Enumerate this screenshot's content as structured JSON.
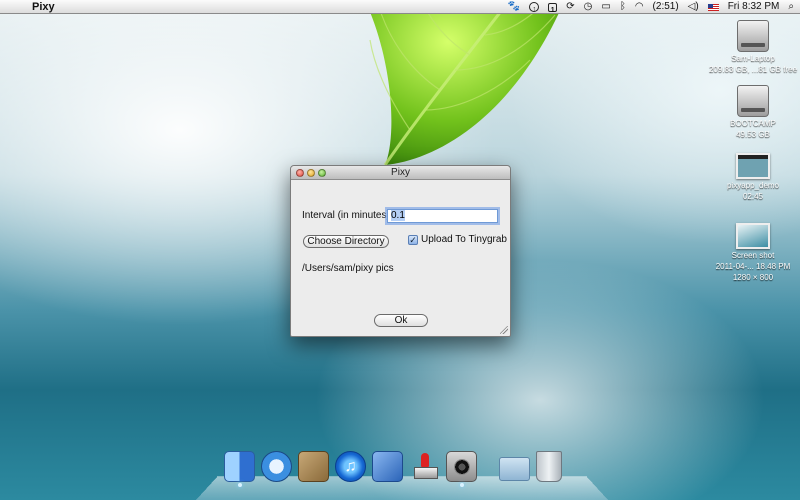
{
  "menubar": {
    "app_name": "Pixy",
    "battery": "(2:51)",
    "clock": "Fri 8:32 PM",
    "icons": [
      "apple-icon",
      "paw-icon",
      "arrow-circle-icon",
      "one-box-icon",
      "sync-icon",
      "time-machine-icon",
      "display-icon",
      "bluetooth-icon",
      "wifi-icon",
      "volume-icon",
      "flag-icon",
      "spotlight-icon"
    ]
  },
  "desktop_icons": [
    {
      "name": "Sam-Laptop",
      "detail": "209.83 GB, ...81 GB free"
    },
    {
      "name": "BOOTCAMP",
      "detail": "49.53 GB"
    },
    {
      "name": "pixyapp_demo",
      "detail": "02:45"
    },
    {
      "name": "Screen shot",
      "detail": "2011-04-... 18.48 PM",
      "size": "1280 × 800"
    }
  ],
  "window": {
    "title": "Pixy",
    "interval_label": "Interval (in minutes):",
    "interval_value": "0.1",
    "choose_directory": "Choose Directory",
    "upload_label": "Upload To Tinygrab",
    "upload_checked": true,
    "directory_path": "/Users/sam/pixy pics",
    "ok_label": "Ok"
  },
  "dock": {
    "items": [
      "Finder",
      "Safari",
      "Mail",
      "iTunes",
      "Xcode",
      "Stamp",
      "Camera",
      "Folder",
      "Trash"
    ]
  }
}
